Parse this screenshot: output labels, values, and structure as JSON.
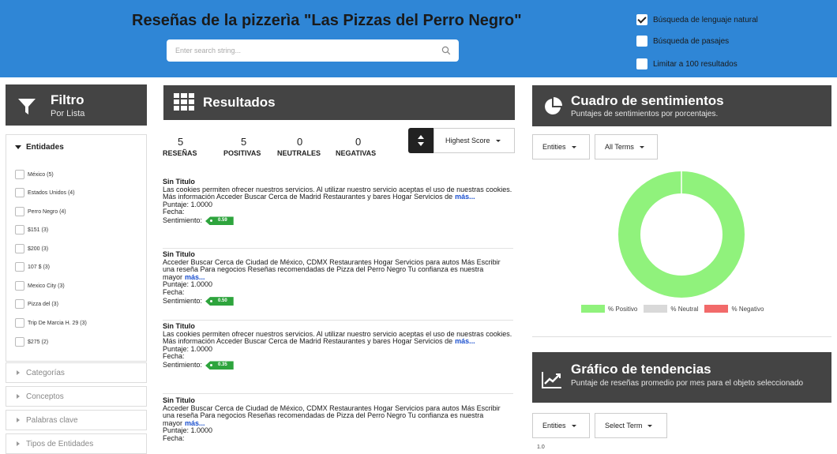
{
  "header": {
    "title": "Reseñas de la pizzerìa \"Las Pizzas del Perro Negro\"",
    "search_placeholder": "Enter search string...",
    "options": [
      {
        "label": "Búsqueda de lenguaje natural",
        "checked": true
      },
      {
        "label": "Búsqueda de pasajes",
        "checked": false
      },
      {
        "label": "Limitar a 100 resultados",
        "checked": false
      }
    ]
  },
  "filter": {
    "title": "Filtro",
    "subtitle": "Por Lista",
    "entities_label": "Entidades",
    "entities": [
      "México (5)",
      "Estados Unidos (4)",
      "Perro Negro (4)",
      "$151 (3)",
      "$200 (3)",
      "107 $ (3)",
      "Mexico City (3)",
      "Pizza del (3)",
      "Trip De Marcia H. 29 (3)",
      "$275 (2)"
    ],
    "collapsed": [
      "Categorías",
      "Conceptos",
      "Palabras clave",
      "Tipos de Entidades"
    ]
  },
  "results": {
    "title": "Resultados",
    "stats": [
      {
        "value": "5",
        "label": "RESEÑAS"
      },
      {
        "value": "5",
        "label": "POSITIVAS"
      },
      {
        "value": "0",
        "label": "NEUTRALES"
      },
      {
        "value": "0",
        "label": "NEGATIVAS"
      }
    ],
    "sort_label": "Highest Score",
    "more_label": "más...",
    "reviews": [
      {
        "title": "Sin Titulo",
        "text": "Las cookies permiten ofrecer nuestros servicios. Al utilizar nuestro servicio aceptas el uso de nuestras cookies. Más información Acceder Buscar Cerca de Madrid Restaurantes y bares Hogar Servicios de",
        "score": "Puntaje: 1.0000",
        "date": "Fecha:",
        "sentiment_label": "Sentimiento:",
        "sentiment": "0.59"
      },
      {
        "title": "Sin Titulo",
        "text": "Acceder Buscar Cerca de Ciudad de México, CDMX Restaurantes Hogar Servicios para autos Más Escribir una reseña Para negocios Reseñas recomendadas de Pizza del Perro Negro Tu confianza es nuestra mayor",
        "score": "Puntaje: 1.0000",
        "date": "Fecha:",
        "sentiment_label": "Sentimiento:",
        "sentiment": "0.50"
      },
      {
        "title": "Sin Titulo",
        "text": "Las cookies permiten ofrecer nuestros servicios. Al utilizar nuestro servicio aceptas el uso de nuestras cookies. Más información Acceder Buscar Cerca de Madrid Restaurantes y bares Hogar Servicios de",
        "score": "Puntaje: 1.0000",
        "date": "Fecha:",
        "sentiment_label": "Sentimiento:",
        "sentiment": "0.35"
      },
      {
        "title": "Sin Titulo",
        "text": "Acceder Buscar Cerca de Ciudad de México, CDMX Restaurantes Hogar Servicios para autos Más Escribir una reseña Para negocios Reseñas recomendadas de Pizza del Perro Negro Tu confianza es nuestra mayor",
        "score": "Puntaje: 1.0000",
        "date": "Fecha:",
        "sentiment_label": "",
        "sentiment": ""
      }
    ]
  },
  "sentiment_panel": {
    "title": "Cuadro de sentimientos",
    "subtitle": "Puntajes de sentimientos por porcentajes.",
    "dropdown1": "Entities",
    "dropdown2": "All Terms",
    "colors": {
      "positive": "#90f27c",
      "neutral": "#d9d9d9",
      "negative": "#f26a6a"
    }
  },
  "chart_data": {
    "type": "pie",
    "categories": [
      "% Positivo",
      "% Neutral",
      "% Negativo"
    ],
    "values": [
      100,
      0,
      0
    ],
    "title": "",
    "legend": "bottom"
  },
  "trend_panel": {
    "title": "Gráfico de tendencias",
    "subtitle": "Puntaje de reseñas promedio por mes para el objeto seleccionado",
    "dropdown1": "Entities",
    "dropdown2": "Select Term",
    "axis_tick": "1.0"
  }
}
